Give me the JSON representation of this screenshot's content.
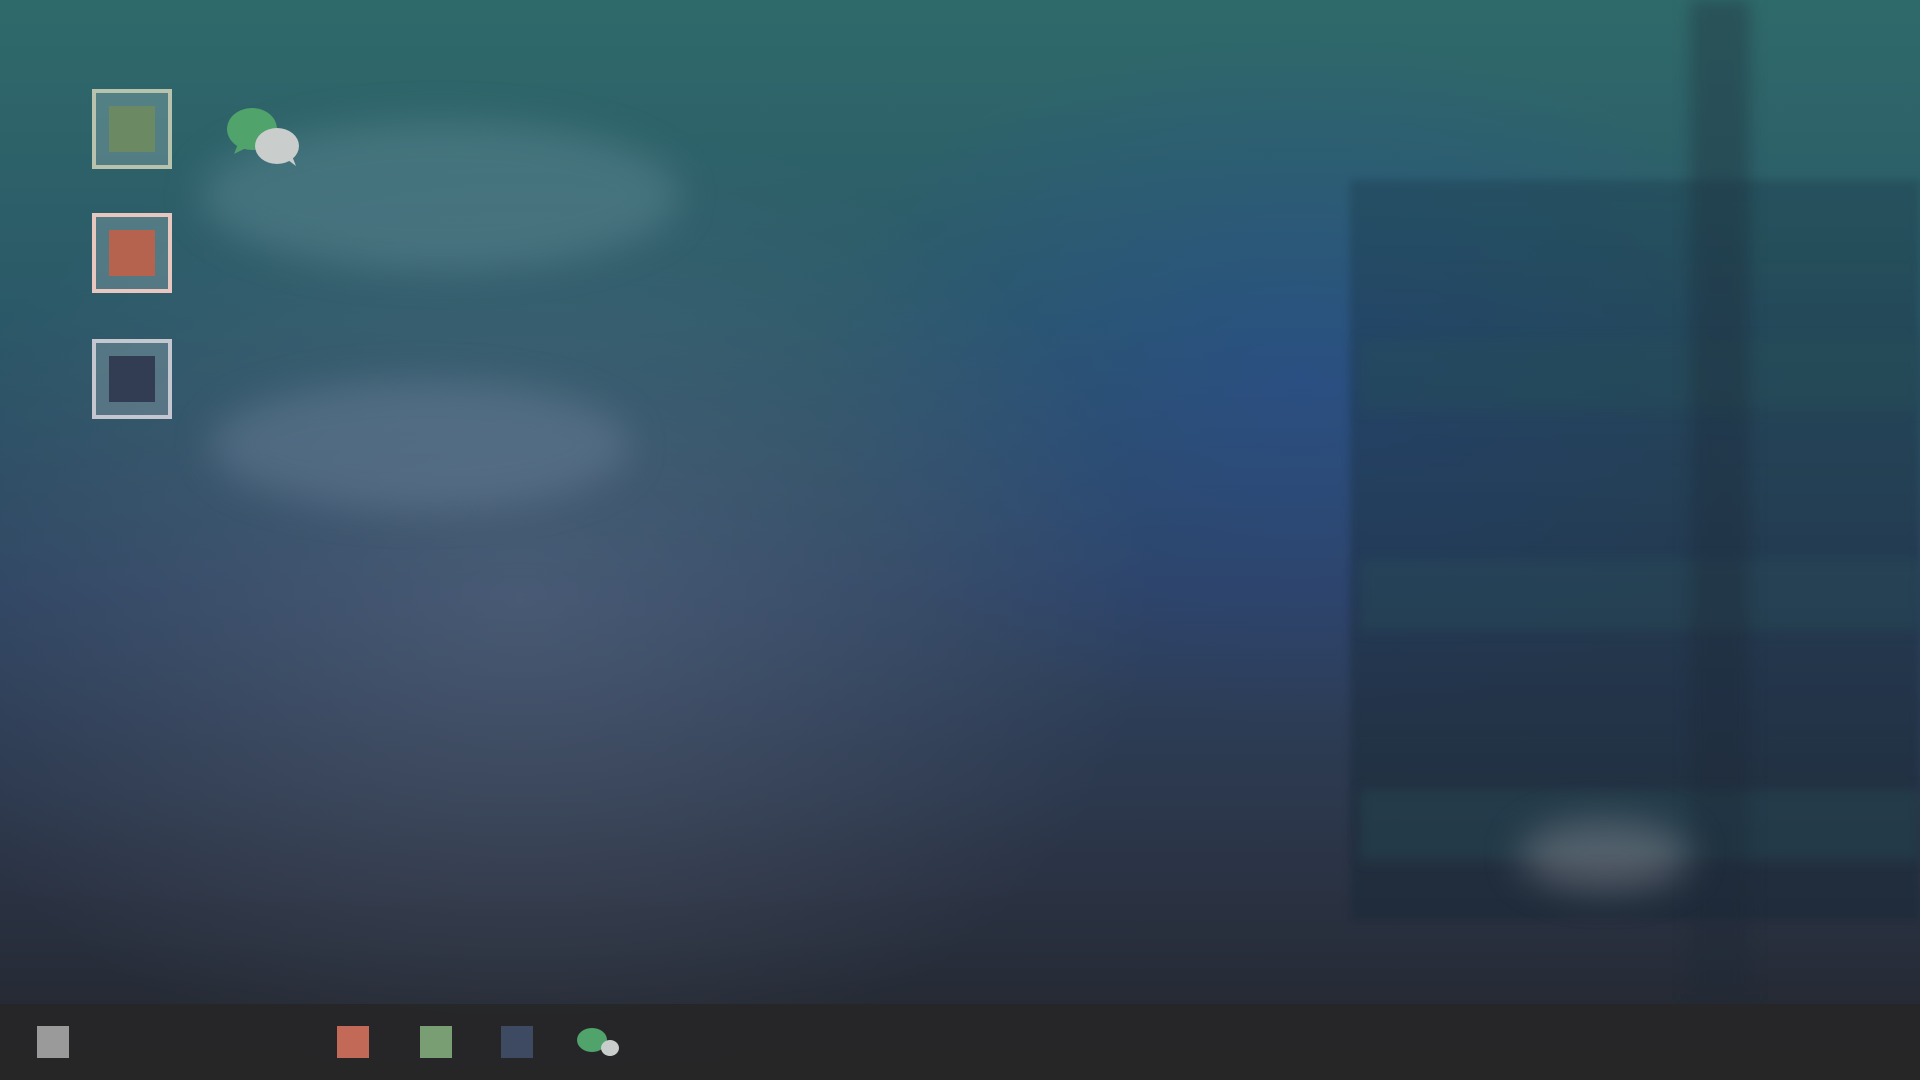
{
  "desktop": {
    "icons": [
      {
        "name": "green-square-app",
        "border_color": "#b7c3ac",
        "fill_color": "#6b8a64"
      },
      {
        "name": "red-square-app",
        "border_color": "#e8c7c0",
        "fill_color": "#b5624f"
      },
      {
        "name": "navy-square-app",
        "border_color": "#c4c7d0",
        "fill_color": "#323d54"
      },
      {
        "name": "chat-app",
        "bubble_front": "#4fa36b",
        "bubble_back": "#c9cdcc"
      }
    ]
  },
  "taskbar": {
    "items": [
      {
        "name": "start-button",
        "color": "#9a9a9a"
      },
      {
        "name": "red-square-app",
        "color": "#c26a57"
      },
      {
        "name": "green-square-app",
        "color": "#7a9e74"
      },
      {
        "name": "navy-square-app",
        "color": "#3d4a62"
      },
      {
        "name": "chat-app",
        "bubble_front": "#4fa36b",
        "bubble_back": "#c9cdcc"
      }
    ]
  }
}
